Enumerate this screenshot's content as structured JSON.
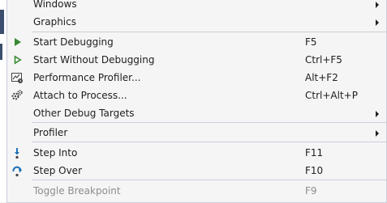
{
  "menu": {
    "items": [
      {
        "label": "Windows",
        "submenu": true
      },
      {
        "label": "Graphics",
        "submenu": true
      },
      {
        "label": "Start Debugging",
        "shortcut": "F5",
        "icon": "play-icon"
      },
      {
        "label": "Start Without Debugging",
        "shortcut": "Ctrl+F5",
        "icon": "play-outline-icon"
      },
      {
        "label": "Performance Profiler...",
        "shortcut": "Alt+F2",
        "icon": "performance-profiler-icon"
      },
      {
        "label": "Attach to Process...",
        "shortcut": "Ctrl+Alt+P",
        "icon": "attach-process-icon"
      },
      {
        "label": "Other Debug Targets",
        "submenu": true
      },
      {
        "label": "Profiler",
        "submenu": true
      },
      {
        "label": "Step Into",
        "shortcut": "F11",
        "icon": "step-into-icon"
      },
      {
        "label": "Step Over",
        "shortcut": "F10",
        "icon": "step-over-icon"
      },
      {
        "label": "Toggle Breakpoint",
        "shortcut": "F9",
        "disabled": true
      }
    ]
  },
  "colors": {
    "menu_background": "#f5f5f5",
    "separator": "#cccedb",
    "play_green": "#388a34",
    "step_blue": "#1e6fb5",
    "disabled_text": "#8d8d8d"
  }
}
